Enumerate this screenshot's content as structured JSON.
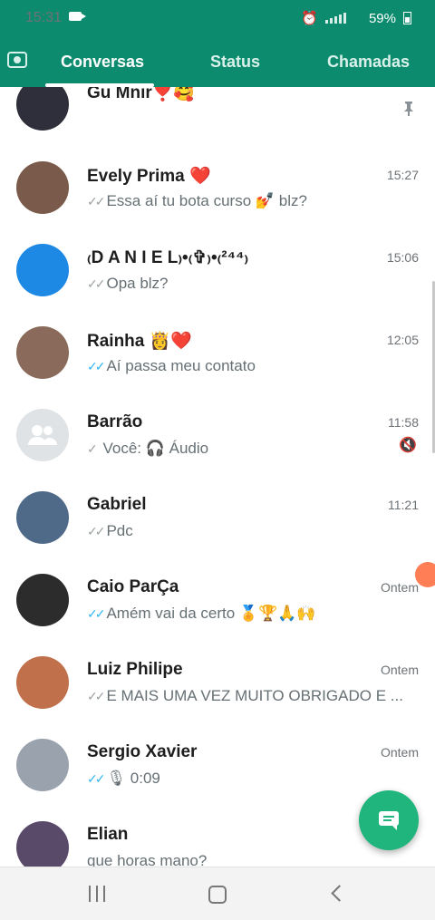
{
  "status_bar": {
    "time": "15:31",
    "battery": "59%"
  },
  "tabs": [
    {
      "label": "Conversas",
      "active": true
    },
    {
      "label": "Status",
      "active": false
    },
    {
      "label": "Chamadas",
      "active": false
    }
  ],
  "chats": [
    {
      "name": "Gu Mnir❣️🥰",
      "time": "",
      "preview": "",
      "pinned": true,
      "avatar_color": "#2e2f3a"
    },
    {
      "name": "Evely Prima ❤️",
      "time": "15:27",
      "ticks": "read-grey",
      "preview": "Essa aí tu bota curso 💅 blz?",
      "avatar_color": "#7a5a4a"
    },
    {
      "name": "₍D A N I E L₎•₍✞₎•₍²⁴⁴₎",
      "time": "15:06",
      "ticks": "read-grey",
      "preview": "Opa blz?",
      "avatar_color": "#1e88e5"
    },
    {
      "name": "Rainha 👸❤️",
      "time": "12:05",
      "ticks": "read-blue",
      "preview": "Aí passa meu contato",
      "avatar_color": "#8a6a5a"
    },
    {
      "name": "Barrão",
      "time": "11:58",
      "ticks": "sent",
      "preview": "Você: 🎧 Áudio",
      "muted": true,
      "avatar_color": "#dfe3e5"
    },
    {
      "name": "Gabriel",
      "time": "11:21",
      "ticks": "read-grey",
      "preview": "Pdc",
      "avatar_color": "#4f6a88"
    },
    {
      "name": "Caio ParÇa",
      "time": "Ontem",
      "ticks": "read-blue",
      "preview": "Amém  vai da certo 🏅🏆🙏🙌",
      "avatar_color": "#2c2c2c"
    },
    {
      "name": "Luiz Philipe",
      "time": "Ontem",
      "ticks": "read-grey",
      "preview": "E MAIS UMA VEZ MUITO OBRIGADO E ...",
      "avatar_color": "#c0704a"
    },
    {
      "name": "Sergio Xavier",
      "time": "Ontem",
      "ticks": "read-blue",
      "preview": "🎙 0:09",
      "avatar_color": "#9aa3ad"
    },
    {
      "name": "Elian",
      "time": "",
      "preview": "que horas mano?",
      "avatar_color": "#5a4a6a"
    }
  ]
}
